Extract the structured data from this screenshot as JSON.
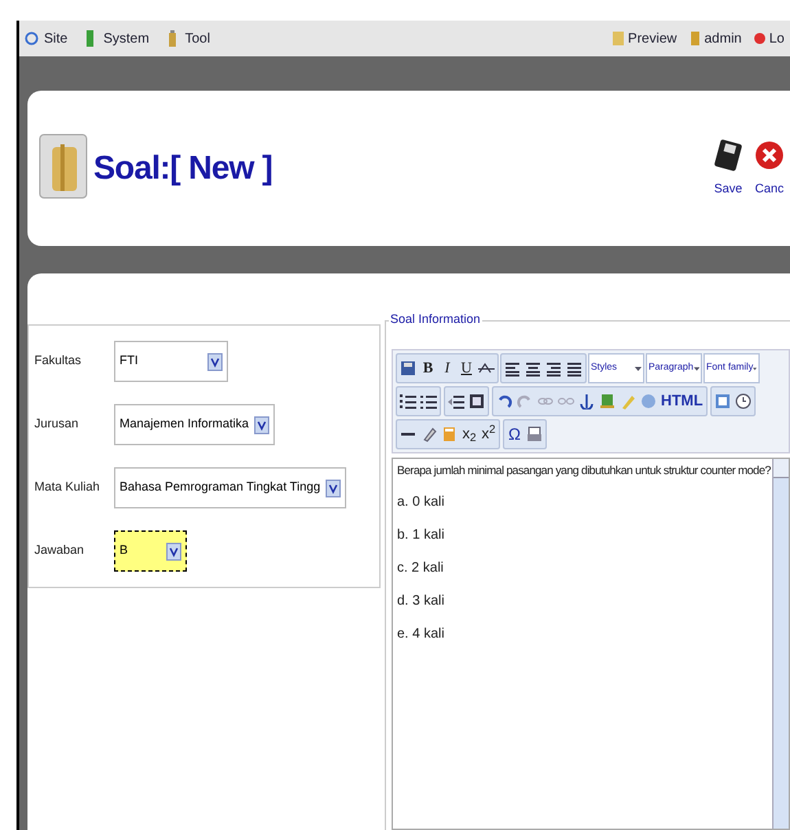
{
  "menu": {
    "left": [
      "Site",
      "System",
      "Tool"
    ],
    "right": [
      "Preview",
      "admin",
      "Lo"
    ]
  },
  "header": {
    "title": "Soal:",
    "subtitle": "[ New ]",
    "buttons": [
      "Save",
      "Canc"
    ]
  },
  "form": {
    "fields": [
      {
        "label": "Fakultas",
        "value": "FTI",
        "focused": false
      },
      {
        "label": "Jurusan",
        "value": "Manajemen Informatika",
        "focused": false
      },
      {
        "label": "Mata Kuliah",
        "value": "Bahasa Pemrograman Tingkat Tingg",
        "focused": false
      },
      {
        "label": "Jawaban",
        "value": "B",
        "focused": true
      }
    ]
  },
  "editor": {
    "legend": "Soal Information",
    "format_buttons": [
      "B",
      "I",
      "U"
    ],
    "dropdowns": [
      "Styles",
      "Paragraph",
      "Font family"
    ],
    "html_button": "HTML",
    "script_buttons": [
      "x$_{2}$",
      "x$^{2}$"
    ],
    "symbol_button": "Ω",
    "content": [
      "Berapa jumlah minimal pasangan yang dibutuhkan untuk struktur counter mode?",
      "a. 0 kali",
      "b. 1 kali",
      "c. 2 kali",
      "d. 3 kali",
      "e. 4 kali"
    ]
  }
}
